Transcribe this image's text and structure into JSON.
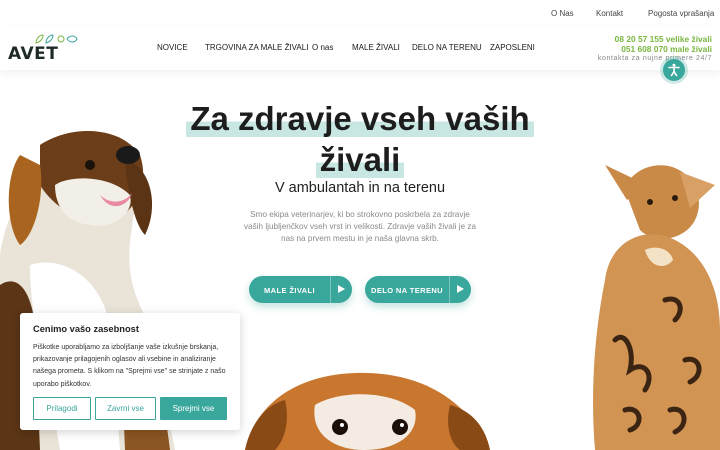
{
  "topbar": {
    "links": [
      "O Nas",
      "Kontakt",
      "Pogosta vprašanja"
    ]
  },
  "logo": {
    "text": "AVET"
  },
  "nav": {
    "items": [
      "NOVICE",
      "TRGOVINA ZA MALE ŽIVALI",
      "O nas",
      "MALE ŽIVALI",
      "DELO NA TERENU",
      "ZAPOSLENI"
    ]
  },
  "contact": {
    "phone_large": "08 20 57 155 velike živali",
    "phone_small": "051 608 070 male živali",
    "note": "kontakta za nujne primere 24/7"
  },
  "hero": {
    "title_line1": "Za zdravje vseh vaših",
    "title_line2": "živali",
    "subtitle": "V ambulantah in na terenu",
    "description": "Smo ekipa veterinarjev, ki bo strokovno poskrbela za zdravje vaših ljubljenčkov vseh vrst in velikosti. Zdravje vaših živali je za nas na prvem mestu in je naša glavna skrb.",
    "buttons": [
      "MALE ŽIVALI",
      "DELO NA TERENU"
    ]
  },
  "cookie": {
    "title": "Cenimo vašo zasebnost",
    "text": "Piškotke uporabljamo za izboljšanje vaše izkušnje brskanja, prikazovanje prilagojenih oglasov ali vsebine in analiziranje našega prometa. S klikom na \"Sprejmi vse\" se strinjate z našo uporabo piškotkov.",
    "customize": "Prilagodi",
    "reject": "Zavrni vse",
    "accept": "Sprejmi vse"
  },
  "colors": {
    "accent": "#3aa79c",
    "phone": "#7ab640",
    "highlight": "#c8e7e3"
  },
  "icons": [
    "accessibility-icon",
    "play-arrow-icon"
  ]
}
